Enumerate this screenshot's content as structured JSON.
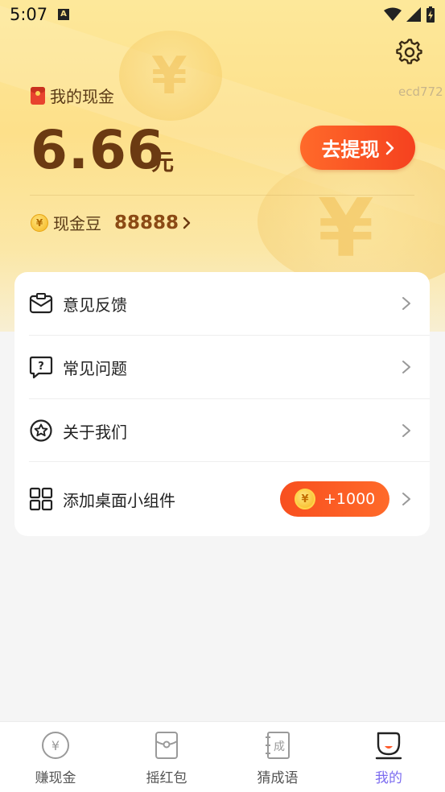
{
  "status_bar": {
    "time": "5:07",
    "notification_letter": "A"
  },
  "header": {
    "wallet_label": "我的现金",
    "user_id": "ecd772",
    "amount": "6.66",
    "amount_unit": "元",
    "withdraw_label": "去提现",
    "beans_label": "现金豆",
    "beans_value": "88888",
    "coin_symbol": "¥"
  },
  "menu": {
    "items": [
      {
        "label": "意见反馈",
        "icon": "feedback-mail-icon"
      },
      {
        "label": "常见问题",
        "icon": "faq-question-icon"
      },
      {
        "label": "关于我们",
        "icon": "about-star-icon"
      },
      {
        "label": "添加桌面小组件",
        "icon": "widget-grid-icon",
        "reward": "+1000"
      }
    ]
  },
  "bottom_nav": {
    "items": [
      {
        "label": "赚现金",
        "icon": "yen-coin-icon",
        "active": false
      },
      {
        "label": "摇红包",
        "icon": "red-packet-icon",
        "active": false
      },
      {
        "label": "猜成语",
        "icon": "idiom-book-icon",
        "active": false
      },
      {
        "label": "我的",
        "icon": "profile-icon",
        "active": true
      }
    ]
  },
  "colors": {
    "accent_orange": "#f5411f",
    "amount_brown": "#6b3a12",
    "active_nav": "#7c6cf0"
  }
}
